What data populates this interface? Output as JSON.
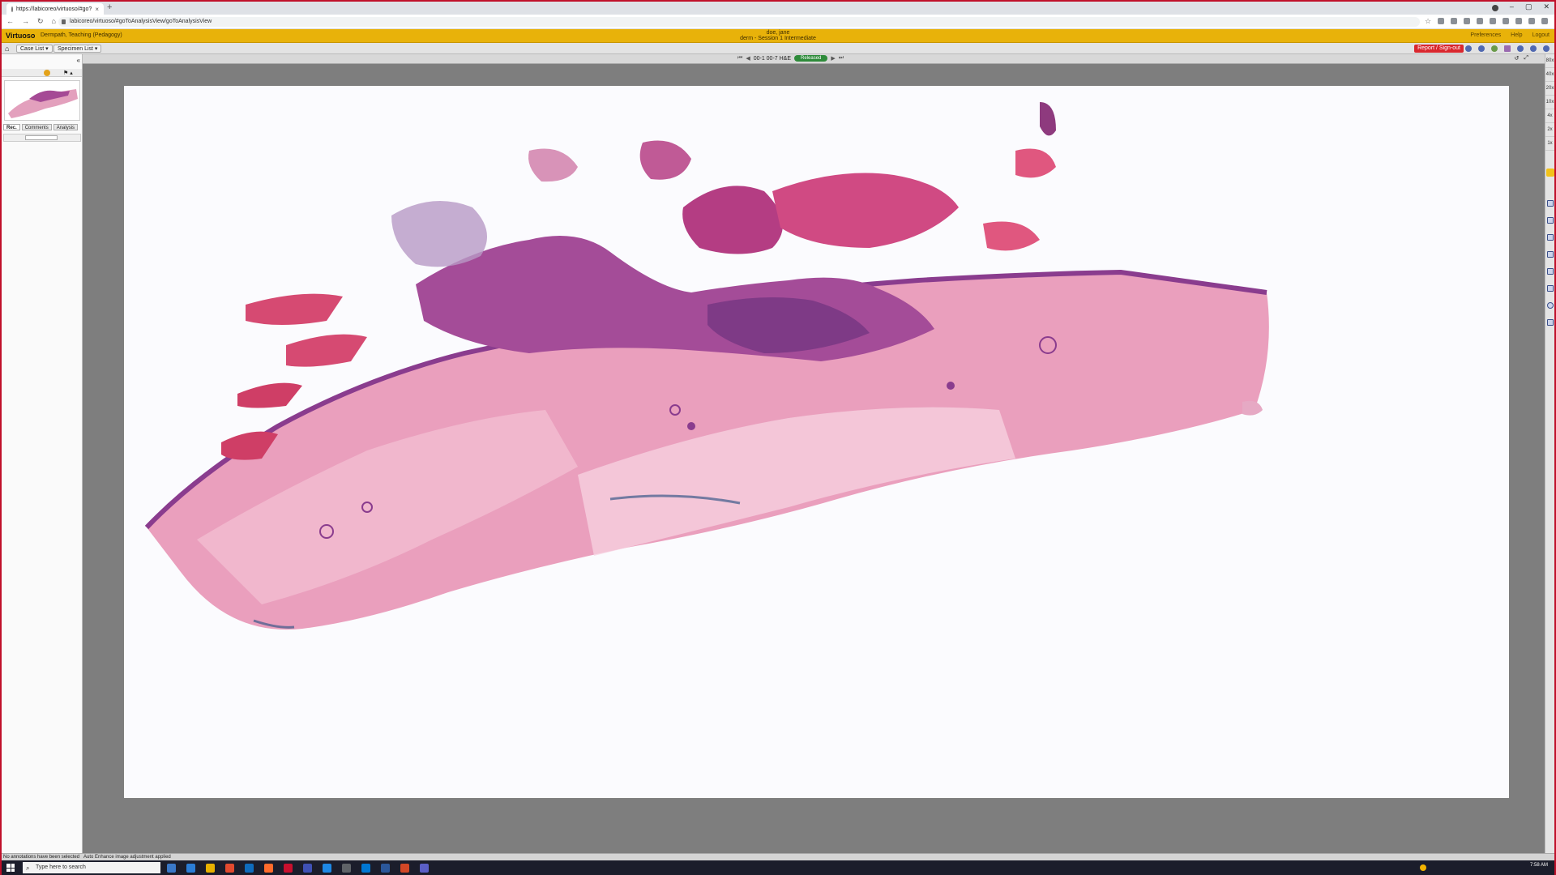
{
  "browser": {
    "tab_title": "https://labicoreo/virtuoso/#go?",
    "url": "labicoreo/virtuoso/#goToAnalysisView/goToAnalysisView"
  },
  "app": {
    "name": "Virtuoso",
    "course": "Dermpath, Teaching (Pedagogy)",
    "user_name": "doe, jane",
    "session": "derm - Session 1 Intermediate",
    "links": [
      "Preferences",
      "Help",
      "Logout"
    ]
  },
  "toolbar": {
    "case_list": "Case List",
    "specimen_list": "Specimen List",
    "report_button": "Report / Sign-out"
  },
  "sidebar": {
    "tabs": [
      "Rec.",
      "Comments",
      "Analysis"
    ]
  },
  "viewer": {
    "slide_label": "00-1 00-7 H&E",
    "status": "Released"
  },
  "zoom_levels": [
    "80x",
    "40x",
    "20x",
    "10x",
    "4x",
    "2x",
    "1x"
  ],
  "statusbar": {
    "annotation_msg": "No annotations have been selected",
    "message": "Auto Enhance image adjustment applied"
  },
  "taskbar": {
    "search_placeholder": "Type here to search",
    "clock": "7:58 AM",
    "app_colors": [
      "#3a78c8",
      "#2b7dd6",
      "#e8b100",
      "#e24a2f",
      "#0f6cbd",
      "#ff6b2c",
      "#c8102e",
      "#3f51b5",
      "#1e88e5",
      "#5f6368",
      "#0078d4",
      "#2b579a",
      "#d24726",
      "#5b5fc7"
    ]
  },
  "colors": {
    "app_header": "#e8b20a",
    "report_button": "#d9272e",
    "released_badge": "#2e8b3a",
    "tissue_light": "#e9a3be",
    "tissue_dark": "#8a3c8e"
  }
}
